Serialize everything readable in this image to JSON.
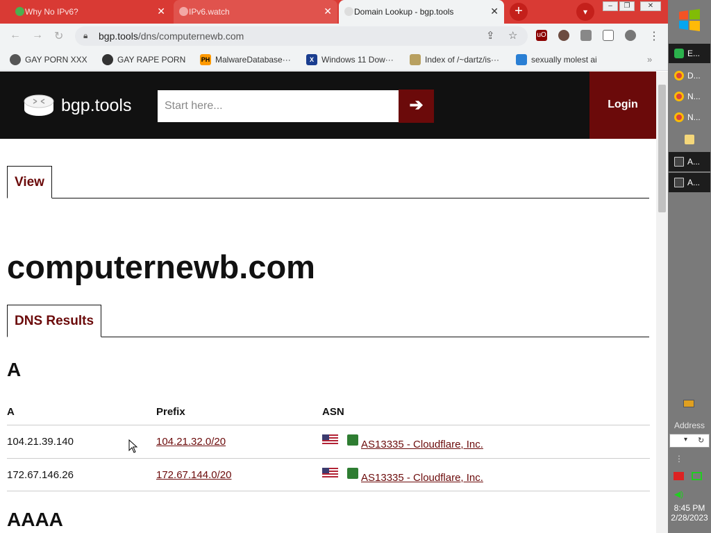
{
  "browser": {
    "tabs": [
      {
        "title": "Why No IPv6?"
      },
      {
        "title": "IPv6.watch"
      },
      {
        "title": "Domain Lookup - bgp.tools"
      }
    ],
    "url_host": "bgp.tools",
    "url_path": "/dns/computernewb.com",
    "bookmarks": [
      {
        "label": "GAY PORN XXX"
      },
      {
        "label": "GAY RAPE PORN"
      },
      {
        "label": "MalwareDatabase···",
        "icon_text": "PH"
      },
      {
        "label": "Windows 11 Dow···",
        "icon_text": "X"
      },
      {
        "label": "Index of /~dartz/is···"
      },
      {
        "label": "sexually molest ai"
      }
    ]
  },
  "site": {
    "logo_text": "bgp.tools",
    "search_placeholder": "Start here...",
    "go_symbol": "➔",
    "login_label": "Login"
  },
  "page": {
    "view_tab": "View",
    "domain": "computernewb.com",
    "dns_tab": "DNS Results",
    "section_a": "A",
    "section_aaaa": "AAAA",
    "table": {
      "headers": [
        "A",
        "Prefix",
        "ASN"
      ],
      "rows": [
        {
          "a": "104.21.39.140",
          "prefix": "104.21.32.0/20",
          "asn": "AS13335 - Cloudflare, Inc."
        },
        {
          "a": "172.67.146.26",
          "prefix": "172.67.144.0/20",
          "asn": "AS13335 - Cloudflare, Inc."
        }
      ]
    }
  },
  "taskbar": {
    "tasks": [
      {
        "label": "E..."
      },
      {
        "label": "D..."
      },
      {
        "label": "N..."
      },
      {
        "label": "N..."
      },
      {
        "label": ""
      },
      {
        "label": "A..."
      },
      {
        "label": "A..."
      }
    ],
    "address_label": "Address",
    "time": "8:45 PM",
    "date": "2/28/2023"
  },
  "colors": {
    "tabstrip": "#d93a34",
    "brand_dark_red": "#6b0a0a",
    "site_header": "#111111"
  }
}
